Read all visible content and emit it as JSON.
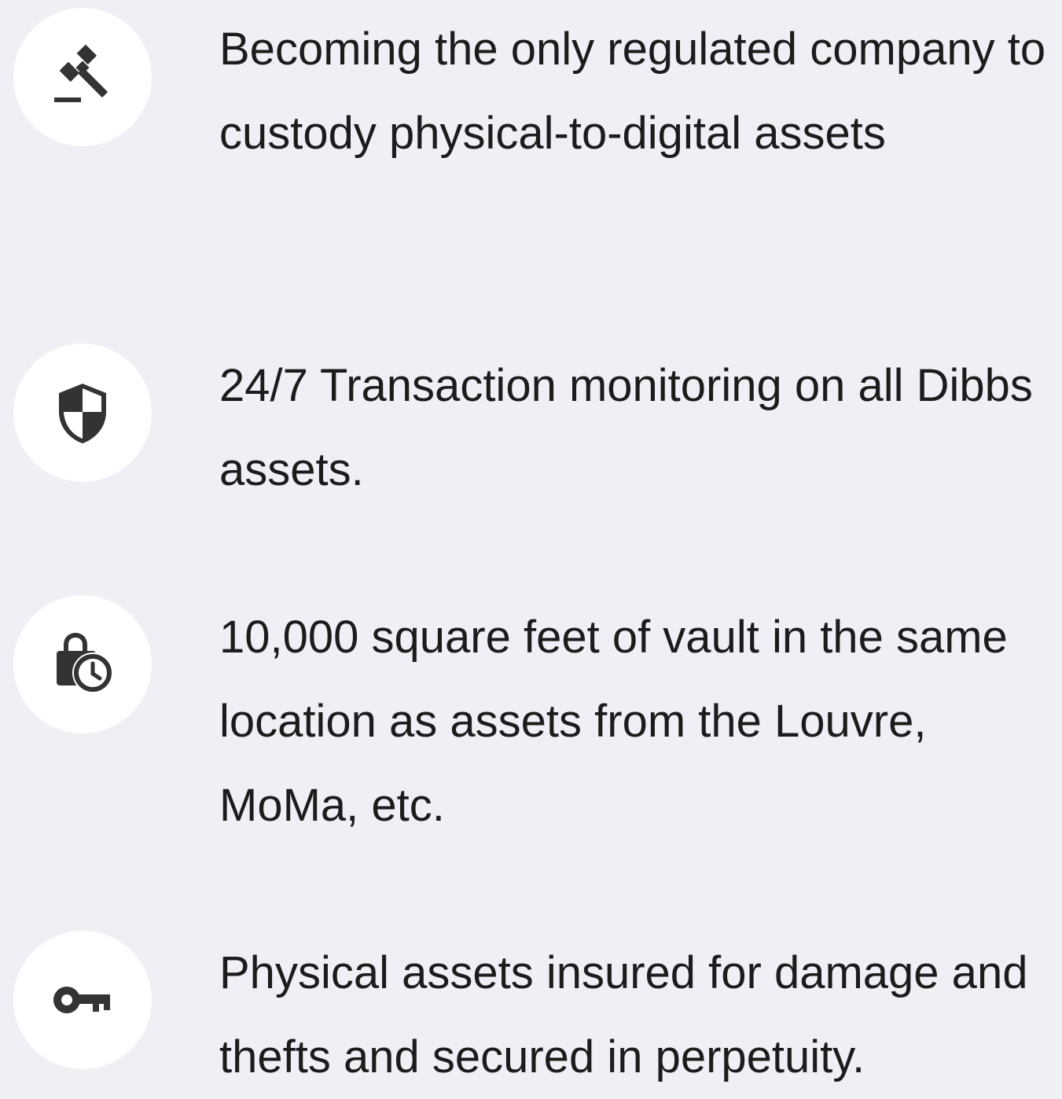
{
  "features": [
    {
      "icon": "gavel-icon",
      "text": "Becoming the only regulated company to custody physical-to-digital assets"
    },
    {
      "icon": "shield-icon",
      "text": "24/7 Transaction monitoring on all Dibbs assets."
    },
    {
      "icon": "lock-clock-icon",
      "text": "10,000 square feet of vault in the same location as assets from the Louvre, MoMa, etc."
    },
    {
      "icon": "key-icon",
      "text": "Physical assets insured for damage and thefts and secured in perpetuity."
    }
  ],
  "colors": {
    "background": "#eff0f5",
    "icon_bg": "#ffffff",
    "icon_fg": "#333333",
    "text": "#1c1c1c"
  }
}
